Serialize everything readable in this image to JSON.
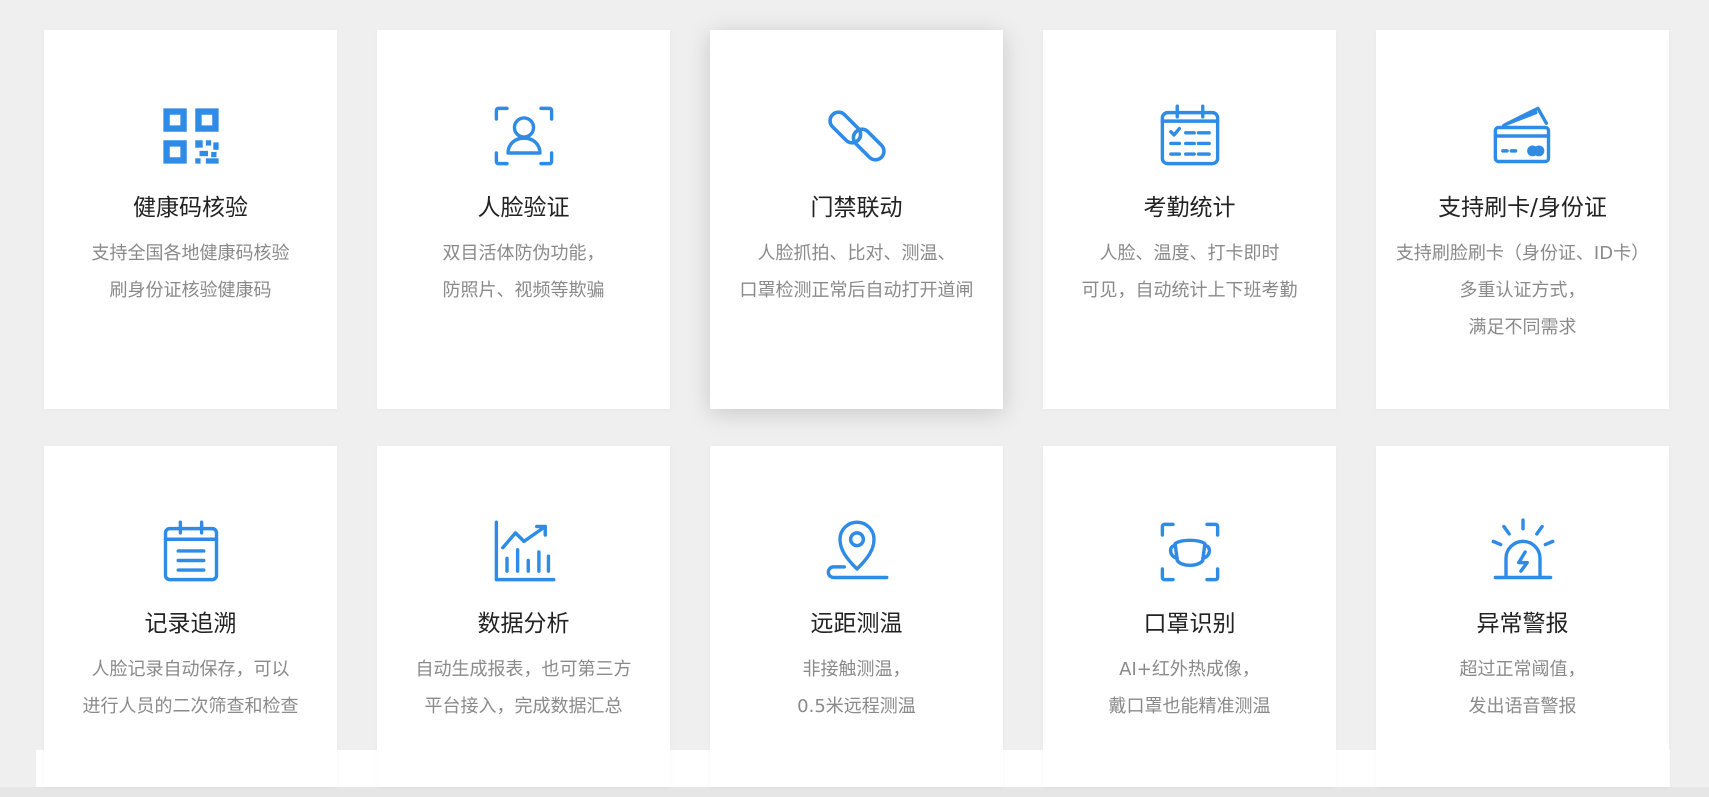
{
  "accent_color": "#2e8be6",
  "features": [
    {
      "icon": "qr-code-icon",
      "title": "健康码核验",
      "desc": [
        "支持全国各地健康码核验",
        "刷身份证核验健康码"
      ]
    },
    {
      "icon": "face-scan-icon",
      "title": "人脸验证",
      "desc": [
        "双目活体防伪功能，",
        "防照片、视频等欺骗"
      ]
    },
    {
      "icon": "link-icon",
      "title": "门禁联动",
      "desc": [
        "人脸抓拍、比对、测温、",
        "口罩检测正常后自动打开道闸"
      ]
    },
    {
      "icon": "calendar-checklist-icon",
      "title": "考勤统计",
      "desc": [
        "人脸、温度、打卡即时",
        "可见，自动统计上下班考勤"
      ]
    },
    {
      "icon": "id-card-icon",
      "title": "支持刷卡/身份证",
      "desc": [
        "支持刷脸刷卡（身份证、ID卡）",
        "多重认证方式，",
        "满足不同需求"
      ]
    },
    {
      "icon": "record-calendar-icon",
      "title": "记录追溯",
      "desc": [
        "人脸记录自动保存，可以",
        "进行人员的二次筛查和检查"
      ]
    },
    {
      "icon": "bar-chart-trend-icon",
      "title": "数据分析",
      "desc": [
        "自动生成报表，也可第三方",
        "平台接入，完成数据汇总"
      ]
    },
    {
      "icon": "location-pin-icon",
      "title": "远距测温",
      "desc": [
        "非接触测温，",
        "0.5米远程测温"
      ]
    },
    {
      "icon": "mask-scan-icon",
      "title": "口罩识别",
      "desc": [
        "AI+红外热成像，",
        "戴口罩也能精准测温"
      ]
    },
    {
      "icon": "alarm-light-icon",
      "title": "异常警报",
      "desc": [
        "超过正常阈值，",
        "发出语音警报"
      ]
    }
  ]
}
